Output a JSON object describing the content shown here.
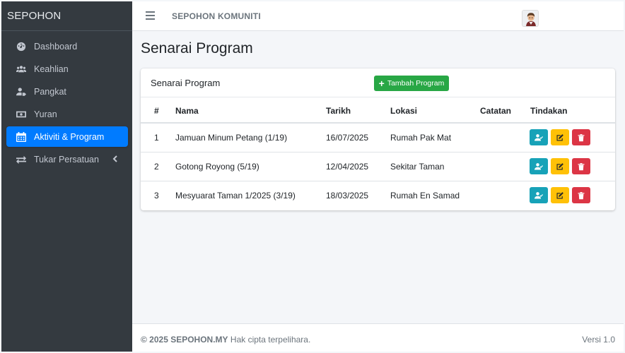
{
  "brand": "SEPOHON",
  "sidebar": {
    "items": [
      {
        "label": "Dashboard",
        "icon": "tachometer-icon"
      },
      {
        "label": "Keahlian",
        "icon": "users-icon"
      },
      {
        "label": "Pangkat",
        "icon": "user-tag-icon"
      },
      {
        "label": "Yuran",
        "icon": "money-bill-icon"
      },
      {
        "label": "Aktiviti & Program",
        "icon": "calendar-icon",
        "active": true
      },
      {
        "label": "Tukar Persatuan",
        "icon": "exchange-icon",
        "has_submenu": true
      }
    ]
  },
  "topbar": {
    "title": "SEPOHON KOMUNITI"
  },
  "page": {
    "title": "Senarai Program"
  },
  "card": {
    "title": "Senarai Program",
    "add_button": "Tambah Program"
  },
  "table": {
    "headers": [
      "#",
      "Nama",
      "Tarikh",
      "Lokasi",
      "Catatan",
      "Tindakan"
    ],
    "rows": [
      {
        "no": "1",
        "nama": "Jamuan Minum Petang (1/19)",
        "tarikh": "16/07/2025",
        "lokasi": "Rumah Pak Mat",
        "catatan": ""
      },
      {
        "no": "2",
        "nama": "Gotong Royong (5/19)",
        "tarikh": "12/04/2025",
        "lokasi": "Sekitar Taman",
        "catatan": ""
      },
      {
        "no": "3",
        "nama": "Mesyuarat Taman 1/2025 (3/19)",
        "tarikh": "18/03/2025",
        "lokasi": "Rumah En Samad",
        "catatan": ""
      }
    ]
  },
  "footer": {
    "copyright": "© 2025 SEPOHON.MY",
    "rights": "Hak cipta terpelihara.",
    "version": "Versi 1.0"
  },
  "colors": {
    "sidebar_bg": "#343a40",
    "active": "#007bff",
    "success": "#28a745",
    "info": "#17a2b8",
    "warning": "#ffc107",
    "danger": "#dc3545"
  }
}
